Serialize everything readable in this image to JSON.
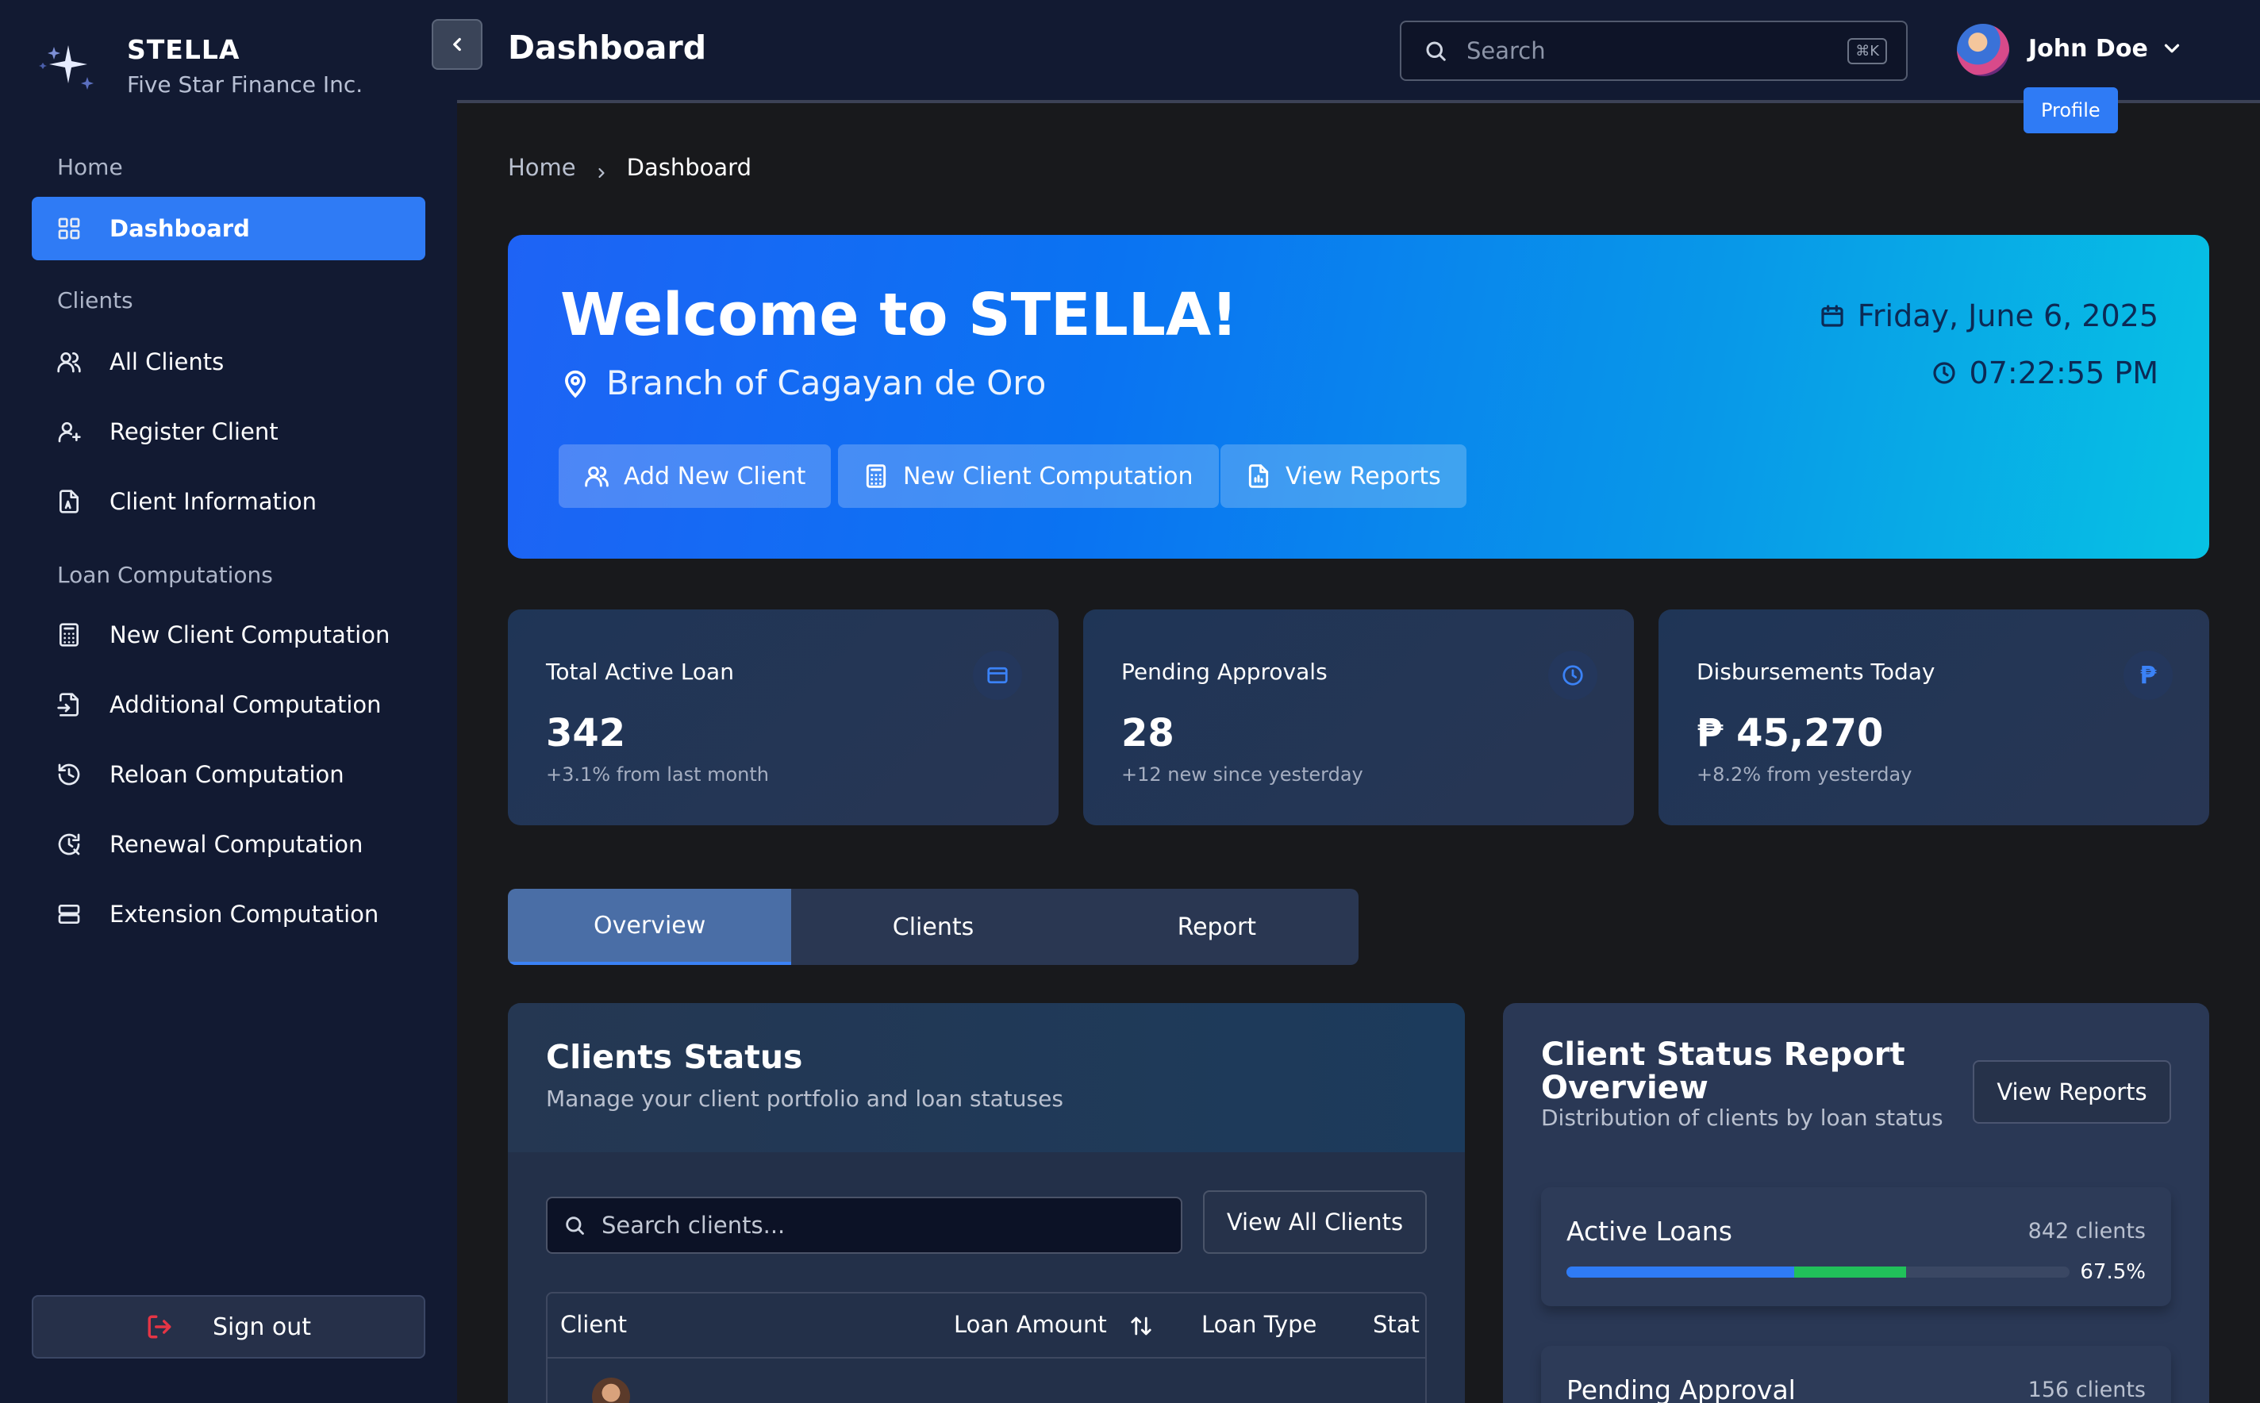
{
  "brand": {
    "name": "STELLA",
    "subtitle": "Five Star Finance Inc."
  },
  "sidebar": {
    "sections": [
      {
        "label": "Home"
      },
      {
        "label": "Clients"
      },
      {
        "label": "Loan Computations"
      }
    ],
    "items": [
      {
        "label": "Dashboard",
        "icon": "grid-icon",
        "active": true
      },
      {
        "label": "All Clients",
        "icon": "users-icon"
      },
      {
        "label": "Register Client",
        "icon": "user-plus-icon"
      },
      {
        "label": "Client Information",
        "icon": "document-icon"
      },
      {
        "label": "New Client Computation",
        "icon": "calculator-icon"
      },
      {
        "label": "Additional Computation",
        "icon": "file-arrow-icon"
      },
      {
        "label": "Reloan Computation",
        "icon": "history-icon"
      },
      {
        "label": "Renewal Computation",
        "icon": "clock-refresh-icon"
      },
      {
        "label": "Extension Computation",
        "icon": "stack-icon"
      }
    ],
    "signout_label": "Sign out"
  },
  "header": {
    "title": "Dashboard",
    "search_placeholder": "Search",
    "search_shortcut": "⌘K",
    "user_name": "John Doe",
    "tooltip": "Profile"
  },
  "breadcrumb": {
    "home": "Home",
    "current": "Dashboard"
  },
  "hero": {
    "title": "Welcome to STELLA!",
    "branch": "Branch of Cagayan de Oro",
    "date": "Friday, June 6, 2025",
    "time": "07:22:55 PM",
    "buttons": [
      {
        "label": "Add New Client",
        "icon": "users-icon"
      },
      {
        "label": "New Client Computation",
        "icon": "calculator-icon"
      },
      {
        "label": "View Reports",
        "icon": "report-icon"
      }
    ]
  },
  "stats": [
    {
      "label": "Total Active Loan",
      "value": "342",
      "sub": "+3.1% from last month",
      "icon": "credit-card-icon"
    },
    {
      "label": "Pending Approvals",
      "value": "28",
      "sub": "+12 new since yesterday",
      "icon": "clock-icon"
    },
    {
      "label": "Disbursements Today",
      "value": "₱ 45,270",
      "sub": "+8.2% from yesterday",
      "icon": "peso-icon",
      "glyph": "₱"
    }
  ],
  "tabs": [
    {
      "label": "Overview",
      "active": true
    },
    {
      "label": "Clients"
    },
    {
      "label": "Report"
    }
  ],
  "clients_panel": {
    "title": "Clients Status",
    "description": "Manage your client portfolio and loan statuses",
    "search_placeholder": "Search clients...",
    "view_all_label": "View All Clients",
    "columns": [
      "Client",
      "Loan Amount",
      "Loan Type",
      "Stat"
    ]
  },
  "report_panel": {
    "title": "Client Status Report Overview",
    "description": "Distribution of clients by loan status",
    "button_label": "View Reports",
    "items": [
      {
        "label": "Active Loans",
        "count": "842 clients",
        "percent": "67.5%",
        "fraction": 0.675
      },
      {
        "label": "Pending Approval",
        "count": "156 clients"
      }
    ]
  },
  "colors": {
    "accent": "#2f7bf5",
    "sidebar": "#121a32",
    "background": "#18191c",
    "success": "#21c05a",
    "danger": "#e53545"
  }
}
